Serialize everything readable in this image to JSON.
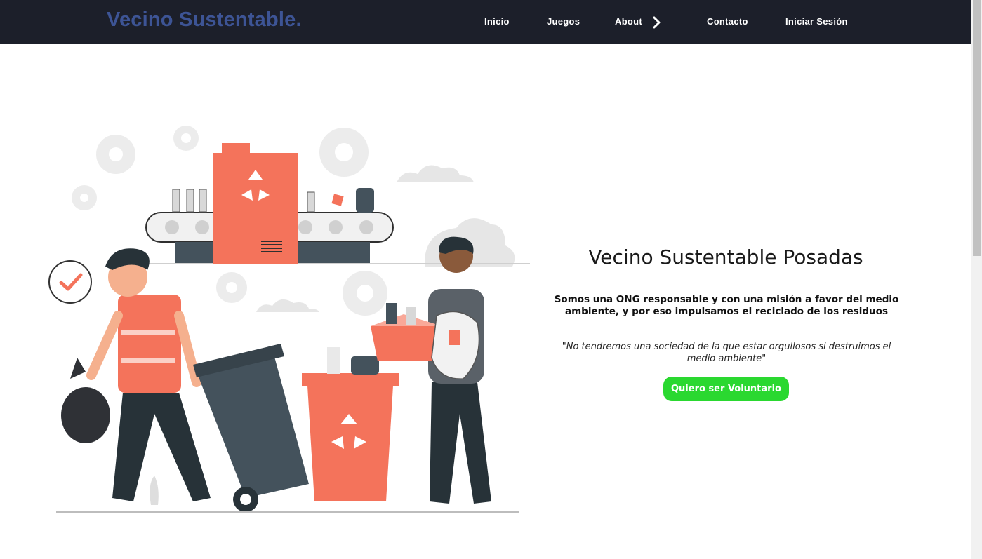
{
  "navbar": {
    "brand": "Vecino Sustentable.",
    "links": [
      {
        "label": "Inicio"
      },
      {
        "label": "Juegos"
      },
      {
        "label": "About"
      },
      {
        "label": "Contacto"
      },
      {
        "label": "Iniciar Sesión"
      }
    ],
    "about_icon": "chevron-right-icon"
  },
  "hero": {
    "title": "Vecino Sustentable Posadas",
    "description": "Somos una ONG responsable y con una misión a favor del medio ambiente, y por eso impulsamos el reciclado de los residuos",
    "quote": "\"No tendremos una sociedad de la que estar orgullosos si destruimos el medio ambiente\"",
    "cta_label": "Quiero ser Voluntario"
  },
  "colors": {
    "navbar_bg": "#1c1f2a",
    "brand": "#3d5495",
    "accent_red": "#f4735b",
    "dark_gray": "#44525c",
    "cta_green": "#2ad830"
  }
}
